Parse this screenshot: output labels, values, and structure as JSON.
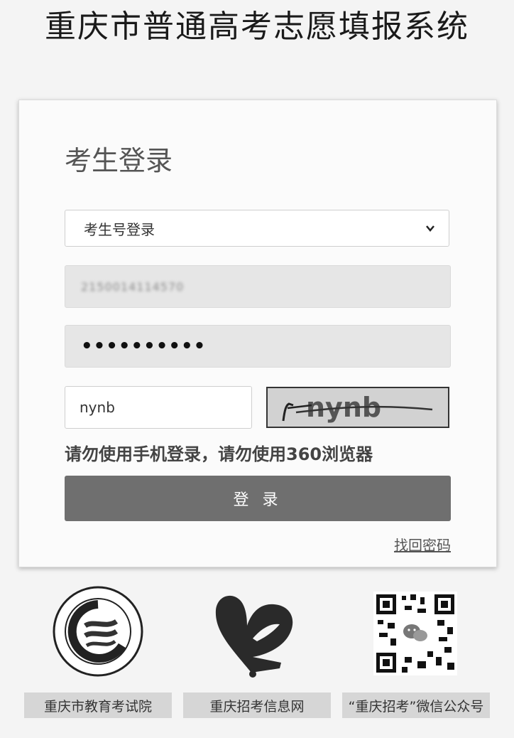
{
  "page": {
    "title": "重庆市普通高考志愿填报系统"
  },
  "login": {
    "heading": "考生登录",
    "login_type": {
      "selected": "考生号登录"
    },
    "username": {
      "value": "2150014114570"
    },
    "password": {
      "value": "••••••••••"
    },
    "captcha": {
      "value": "nynb",
      "image_text": "nynb"
    },
    "notice": "请勿使用手机登录，请勿使用360浏览器",
    "submit_label": "登 录",
    "forgot_label": "找回密码"
  },
  "footer": {
    "items": [
      {
        "label": "重庆市教育考试院",
        "icon": "exam-authority-seal-icon"
      },
      {
        "label": "重庆招考信息网",
        "icon": "heart-logo-icon"
      },
      {
        "label": "“重庆招考”微信公众号",
        "icon": "qr-code-icon"
      }
    ]
  },
  "colors": {
    "button_bg": "#6f6f6f",
    "card_bg": "#fbfbfb",
    "page_bg": "#f4f4f4"
  }
}
